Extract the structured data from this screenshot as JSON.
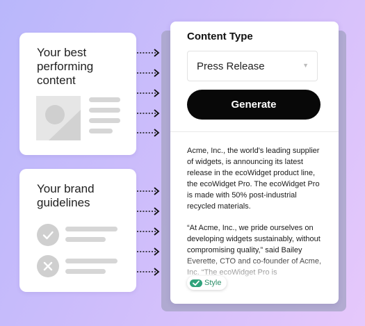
{
  "cards": {
    "content": {
      "title": "Your best performing content"
    },
    "brand": {
      "title": "Your brand guidelines"
    }
  },
  "panel": {
    "heading": "Content Type",
    "select": {
      "value": "Press Release",
      "icon": "chevron-down-icon"
    },
    "generate_label": "Generate",
    "output_paragraphs": [
      "Acme, Inc., the world's leading supplier of widgets, is announcing its latest release in the ecoWidget product line, the ecoWidget Pro. The ecoWidget Pro is made with 50% post-industrial recycled materials.",
      "“At Acme, Inc., we pride ourselves on developing widgets sustainably, without compromising quality,” said Bailey Everette, CTO and co-founder of Acme, Inc. “The ecoWidget Pro is"
    ],
    "style_chip": {
      "label": "Style",
      "icon": "check-toggle-icon",
      "color": "#2fa37c"
    }
  },
  "colors": {
    "background_start": "#b9b7fb",
    "background_end": "#e6c8fb",
    "button": "#080808",
    "placeholder": "#d6d6d6"
  }
}
